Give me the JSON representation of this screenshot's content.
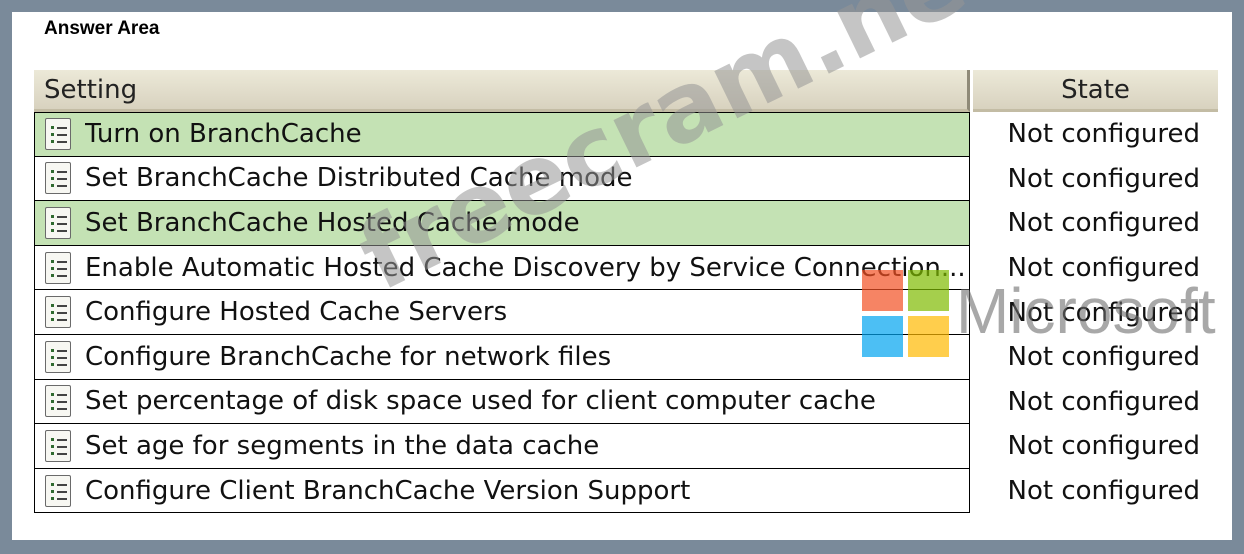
{
  "title": "Answer Area",
  "columns": {
    "setting": "Setting",
    "state": "State"
  },
  "rows": [
    {
      "label": "Turn on BranchCache",
      "state": "Not configured",
      "highlight": true
    },
    {
      "label": "Set BranchCache Distributed Cache mode",
      "state": "Not configured",
      "highlight": false
    },
    {
      "label": "Set BranchCache Hosted Cache mode",
      "state": "Not configured",
      "highlight": true
    },
    {
      "label": "Enable Automatic Hosted Cache Discovery by Service Connection...",
      "state": "Not configured",
      "highlight": false
    },
    {
      "label": "Configure Hosted Cache Servers",
      "state": "Not configured",
      "highlight": false
    },
    {
      "label": "Configure BranchCache for network files",
      "state": "Not configured",
      "highlight": false
    },
    {
      "label": "Set percentage of disk space used for client computer cache",
      "state": "Not configured",
      "highlight": false
    },
    {
      "label": "Set age for segments in the data cache",
      "state": "Not configured",
      "highlight": false
    },
    {
      "label": "Configure Client BranchCache Version Support",
      "state": "Not configured",
      "highlight": false
    }
  ],
  "watermark": "freecram.net",
  "brand_text": "Microsoft",
  "colors": {
    "highlight": "#c4e2b4",
    "logo_red": "#f25022",
    "logo_green": "#7fba00",
    "logo_blue": "#00a4ef",
    "logo_yellow": "#ffb900"
  },
  "icons": {
    "row_icon": "policy-setting-icon"
  }
}
